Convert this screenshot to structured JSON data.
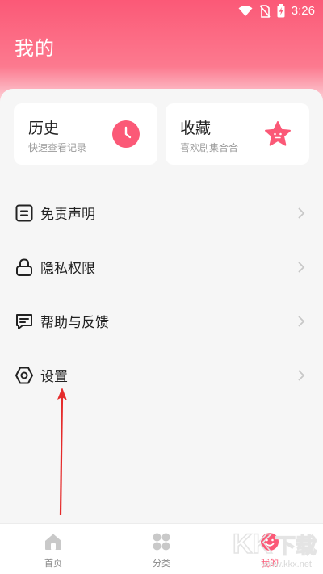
{
  "status_bar": {
    "time": "3:26"
  },
  "header": {
    "title": "我的"
  },
  "cards": [
    {
      "title": "历史",
      "subtitle": "快速查看记录",
      "icon": "clock-icon"
    },
    {
      "title": "收藏",
      "subtitle": "喜欢剧集合合",
      "icon": "star-icon"
    }
  ],
  "menu": [
    {
      "label": "免责声明",
      "icon": "document-icon"
    },
    {
      "label": "隐私权限",
      "icon": "lock-icon"
    },
    {
      "label": "帮助与反馈",
      "icon": "feedback-icon"
    },
    {
      "label": "设置",
      "icon": "settings-hex-icon"
    }
  ],
  "bottom_nav": [
    {
      "label": "首页",
      "icon": "home-icon",
      "active": false
    },
    {
      "label": "分类",
      "icon": "grid-icon",
      "active": false
    },
    {
      "label": "我的",
      "icon": "profile-icon",
      "active": true
    }
  ],
  "watermark": {
    "text": "www.kkx.net",
    "logo_text": "KK下载"
  },
  "colors": {
    "accent": "#fb5977",
    "background": "#f6f6f6",
    "annotation": "#e52b2b"
  }
}
